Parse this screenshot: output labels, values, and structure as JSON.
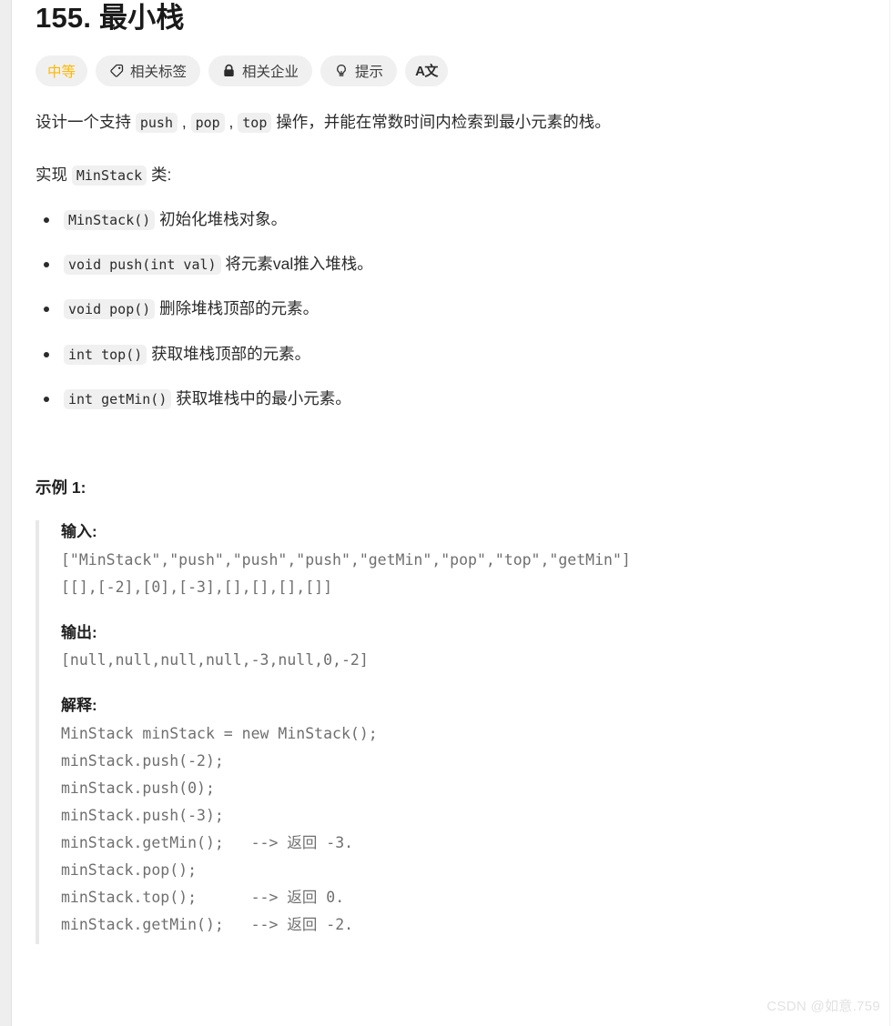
{
  "problem": {
    "title": "155. 最小栈",
    "badges": [
      {
        "id": "difficulty",
        "icon": "none",
        "label": "中等",
        "color": "#ffb800"
      },
      {
        "id": "related-tags",
        "icon": "tag-icon",
        "label": "相关标签"
      },
      {
        "id": "related-companies",
        "icon": "lock-icon",
        "label": "相关企业"
      },
      {
        "id": "hint",
        "icon": "bulb-icon",
        "label": "提示"
      },
      {
        "id": "translate",
        "icon": "translate-icon",
        "label": "A文"
      }
    ],
    "description": {
      "line1_part1": "设计一个支持 ",
      "line1_code1": "push",
      "line1_sep1": " , ",
      "line1_code2": "pop",
      "line1_sep2": " , ",
      "line1_code3": "top",
      "line1_part2": " 操作，并能在常数时间内检索到最小元素的栈。",
      "line2_part1": "实现 ",
      "line2_code": "MinStack",
      "line2_part2": " 类:"
    },
    "methods": [
      {
        "signature": "MinStack()",
        "text": " 初始化堆栈对象。"
      },
      {
        "signature": "void push(int val)",
        "text": " 将元素val推入堆栈。"
      },
      {
        "signature": "void pop()",
        "text": " 删除堆栈顶部的元素。"
      },
      {
        "signature": "int top()",
        "text": " 获取堆栈顶部的元素。"
      },
      {
        "signature": "int getMin()",
        "text": " 获取堆栈中的最小元素。"
      }
    ],
    "example": {
      "heading": "示例 1:",
      "input_label": "输入:",
      "input_code": "[\"MinStack\",\"push\",\"push\",\"push\",\"getMin\",\"pop\",\"top\",\"getMin\"]\n[[],[-2],[0],[-3],[],[],[],[]]",
      "output_label": "输出:",
      "output_code": "[null,null,null,null,-3,null,0,-2]",
      "explanation_label": "解释:",
      "explanation_code": "MinStack minStack = new MinStack();\nminStack.push(-2);\nminStack.push(0);\nminStack.push(-3);\nminStack.getMin();   --> 返回 -3.\nminStack.pop();\nminStack.top();      --> 返回 0.\nminStack.getMin();   --> 返回 -2."
    }
  },
  "watermark": "CSDN @如意.759"
}
